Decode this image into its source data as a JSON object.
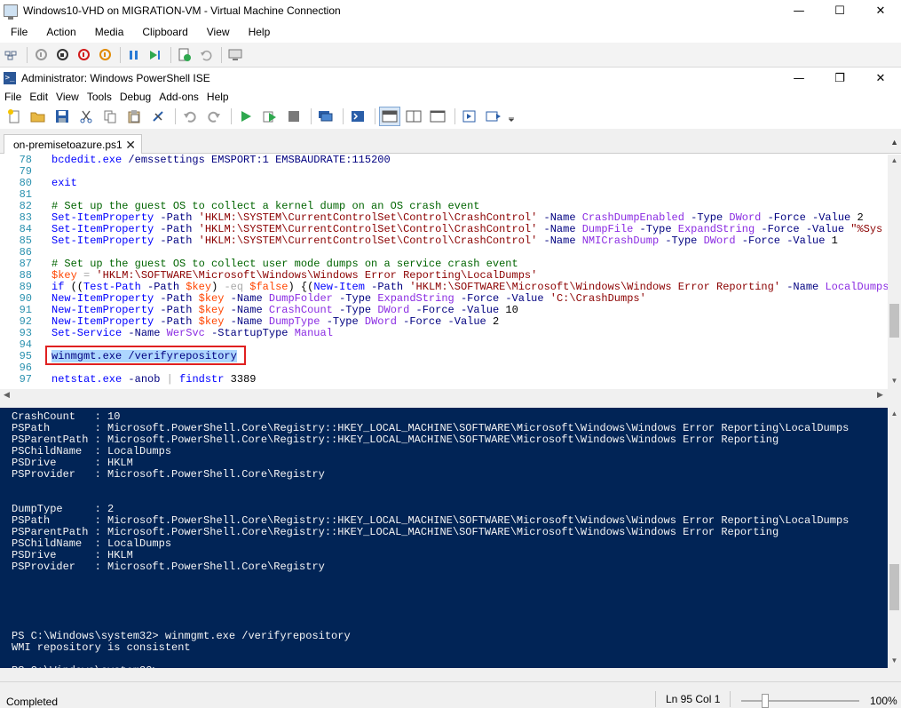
{
  "vm_window": {
    "title": "Windows10-VHD on MIGRATION-VM - Virtual Machine Connection",
    "menu": [
      "File",
      "Action",
      "Media",
      "Clipboard",
      "View",
      "Help"
    ]
  },
  "ise_window": {
    "title": "Administrator: Windows PowerShell ISE",
    "menu": [
      "File",
      "Edit",
      "View",
      "Tools",
      "Debug",
      "Add-ons",
      "Help"
    ]
  },
  "tab": {
    "label": "on-premisetoazure.ps1",
    "close": "✕"
  },
  "editor": {
    "lines": [
      {
        "num": "78",
        "parts": [
          [
            "cmd",
            "bcdedit.exe"
          ],
          [
            "plain",
            " "
          ],
          [
            "param",
            "/emssettings"
          ],
          [
            "plain",
            " "
          ],
          [
            "param",
            "EMSPORT:1"
          ],
          [
            "plain",
            " "
          ],
          [
            "param",
            "EMSBAUDRATE:115200"
          ]
        ]
      },
      {
        "num": "79",
        "parts": []
      },
      {
        "num": "80",
        "parts": [
          [
            "cmd",
            "exit"
          ]
        ]
      },
      {
        "num": "81",
        "parts": []
      },
      {
        "num": "82",
        "parts": [
          [
            "com",
            "# Set up the guest OS to collect a kernel dump on an OS crash event"
          ]
        ]
      },
      {
        "num": "83",
        "parts": [
          [
            "cmd",
            "Set-ItemProperty"
          ],
          [
            "plain",
            " "
          ],
          [
            "param",
            "-Path"
          ],
          [
            "plain",
            " "
          ],
          [
            "str",
            "'HKLM:\\SYSTEM\\CurrentControlSet\\Control\\CrashControl'"
          ],
          [
            "plain",
            " "
          ],
          [
            "param",
            "-Name"
          ],
          [
            "plain",
            " "
          ],
          [
            "type",
            "CrashDumpEnabled"
          ],
          [
            "plain",
            " "
          ],
          [
            "param",
            "-Type"
          ],
          [
            "plain",
            " "
          ],
          [
            "type",
            "DWord"
          ],
          [
            "plain",
            " "
          ],
          [
            "param",
            "-Force"
          ],
          [
            "plain",
            " "
          ],
          [
            "param",
            "-Value"
          ],
          [
            "plain",
            " "
          ],
          [
            "plain",
            "2"
          ]
        ]
      },
      {
        "num": "84",
        "parts": [
          [
            "cmd",
            "Set-ItemProperty"
          ],
          [
            "plain",
            " "
          ],
          [
            "param",
            "-Path"
          ],
          [
            "plain",
            " "
          ],
          [
            "str",
            "'HKLM:\\SYSTEM\\CurrentControlSet\\Control\\CrashControl'"
          ],
          [
            "plain",
            " "
          ],
          [
            "param",
            "-Name"
          ],
          [
            "plain",
            " "
          ],
          [
            "type",
            "DumpFile"
          ],
          [
            "plain",
            " "
          ],
          [
            "param",
            "-Type"
          ],
          [
            "plain",
            " "
          ],
          [
            "type",
            "ExpandString"
          ],
          [
            "plain",
            " "
          ],
          [
            "param",
            "-Force"
          ],
          [
            "plain",
            " "
          ],
          [
            "param",
            "-Value"
          ],
          [
            "plain",
            " "
          ],
          [
            "str",
            "\"%Sys"
          ]
        ]
      },
      {
        "num": "85",
        "parts": [
          [
            "cmd",
            "Set-ItemProperty"
          ],
          [
            "plain",
            " "
          ],
          [
            "param",
            "-Path"
          ],
          [
            "plain",
            " "
          ],
          [
            "str",
            "'HKLM:\\SYSTEM\\CurrentControlSet\\Control\\CrashControl'"
          ],
          [
            "plain",
            " "
          ],
          [
            "param",
            "-Name"
          ],
          [
            "plain",
            " "
          ],
          [
            "type",
            "NMICrashDump"
          ],
          [
            "plain",
            " "
          ],
          [
            "param",
            "-Type"
          ],
          [
            "plain",
            " "
          ],
          [
            "type",
            "DWord"
          ],
          [
            "plain",
            " "
          ],
          [
            "param",
            "-Force"
          ],
          [
            "plain",
            " "
          ],
          [
            "param",
            "-Value"
          ],
          [
            "plain",
            " "
          ],
          [
            "plain",
            "1"
          ]
        ]
      },
      {
        "num": "86",
        "parts": []
      },
      {
        "num": "87",
        "parts": [
          [
            "com",
            "# Set up the guest OS to collect user mode dumps on a service crash event"
          ]
        ]
      },
      {
        "num": "88",
        "parts": [
          [
            "var",
            "$key"
          ],
          [
            "plain",
            " "
          ],
          [
            "op",
            "="
          ],
          [
            "plain",
            " "
          ],
          [
            "str",
            "'HKLM:\\SOFTWARE\\Microsoft\\Windows\\Windows Error Reporting\\LocalDumps'"
          ]
        ]
      },
      {
        "num": "89",
        "parts": [
          [
            "cmd",
            "if"
          ],
          [
            "plain",
            " (("
          ],
          [
            "cmd",
            "Test-Path"
          ],
          [
            "plain",
            " "
          ],
          [
            "param",
            "-Path"
          ],
          [
            "plain",
            " "
          ],
          [
            "var",
            "$key"
          ],
          [
            "plain",
            ") "
          ],
          [
            "op",
            "-eq"
          ],
          [
            "plain",
            " "
          ],
          [
            "var",
            "$false"
          ],
          [
            "plain",
            ") {("
          ],
          [
            "cmd",
            "New-Item"
          ],
          [
            "plain",
            " "
          ],
          [
            "param",
            "-Path"
          ],
          [
            "plain",
            " "
          ],
          [
            "str",
            "'HKLM:\\SOFTWARE\\Microsoft\\Windows\\Windows Error Reporting'"
          ],
          [
            "plain",
            " "
          ],
          [
            "param",
            "-Name"
          ],
          [
            "plain",
            " "
          ],
          [
            "type",
            "LocalDumps"
          ]
        ]
      },
      {
        "num": "90",
        "parts": [
          [
            "cmd",
            "New-ItemProperty"
          ],
          [
            "plain",
            " "
          ],
          [
            "param",
            "-Path"
          ],
          [
            "plain",
            " "
          ],
          [
            "var",
            "$key"
          ],
          [
            "plain",
            " "
          ],
          [
            "param",
            "-Name"
          ],
          [
            "plain",
            " "
          ],
          [
            "type",
            "DumpFolder"
          ],
          [
            "plain",
            " "
          ],
          [
            "param",
            "-Type"
          ],
          [
            "plain",
            " "
          ],
          [
            "type",
            "ExpandString"
          ],
          [
            "plain",
            " "
          ],
          [
            "param",
            "-Force"
          ],
          [
            "plain",
            " "
          ],
          [
            "param",
            "-Value"
          ],
          [
            "plain",
            " "
          ],
          [
            "str",
            "'C:\\CrashDumps'"
          ]
        ]
      },
      {
        "num": "91",
        "parts": [
          [
            "cmd",
            "New-ItemProperty"
          ],
          [
            "plain",
            " "
          ],
          [
            "param",
            "-Path"
          ],
          [
            "plain",
            " "
          ],
          [
            "var",
            "$key"
          ],
          [
            "plain",
            " "
          ],
          [
            "param",
            "-Name"
          ],
          [
            "plain",
            " "
          ],
          [
            "type",
            "CrashCount"
          ],
          [
            "plain",
            " "
          ],
          [
            "param",
            "-Type"
          ],
          [
            "plain",
            " "
          ],
          [
            "type",
            "DWord"
          ],
          [
            "plain",
            " "
          ],
          [
            "param",
            "-Force"
          ],
          [
            "plain",
            " "
          ],
          [
            "param",
            "-Value"
          ],
          [
            "plain",
            " "
          ],
          [
            "plain",
            "10"
          ]
        ]
      },
      {
        "num": "92",
        "parts": [
          [
            "cmd",
            "New-ItemProperty"
          ],
          [
            "plain",
            " "
          ],
          [
            "param",
            "-Path"
          ],
          [
            "plain",
            " "
          ],
          [
            "var",
            "$key"
          ],
          [
            "plain",
            " "
          ],
          [
            "param",
            "-Name"
          ],
          [
            "plain",
            " "
          ],
          [
            "type",
            "DumpType"
          ],
          [
            "plain",
            " "
          ],
          [
            "param",
            "-Type"
          ],
          [
            "plain",
            " "
          ],
          [
            "type",
            "DWord"
          ],
          [
            "plain",
            " "
          ],
          [
            "param",
            "-Force"
          ],
          [
            "plain",
            " "
          ],
          [
            "param",
            "-Value"
          ],
          [
            "plain",
            " "
          ],
          [
            "plain",
            "2"
          ]
        ]
      },
      {
        "num": "93",
        "parts": [
          [
            "cmd",
            "Set-Service"
          ],
          [
            "plain",
            " "
          ],
          [
            "param",
            "-Name"
          ],
          [
            "plain",
            " "
          ],
          [
            "type",
            "WerSvc"
          ],
          [
            "plain",
            " "
          ],
          [
            "param",
            "-StartupType"
          ],
          [
            "plain",
            " "
          ],
          [
            "type",
            "Manual"
          ]
        ]
      },
      {
        "num": "94",
        "parts": []
      },
      {
        "num": "95",
        "parts": [
          [
            "sel",
            "winmgmt.exe /verifyrepository"
          ]
        ]
      },
      {
        "num": "96",
        "parts": []
      },
      {
        "num": "97",
        "parts": [
          [
            "cmd",
            "netstat.exe"
          ],
          [
            "plain",
            " "
          ],
          [
            "param",
            "-anob"
          ],
          [
            "plain",
            " "
          ],
          [
            "op",
            "|"
          ],
          [
            "plain",
            " "
          ],
          [
            "cmd",
            "findstr"
          ],
          [
            "plain",
            " "
          ],
          [
            "plain",
            "3389"
          ]
        ]
      }
    ]
  },
  "console": {
    "lines": [
      "CrashCount   : 10",
      "PSPath       : Microsoft.PowerShell.Core\\Registry::HKEY_LOCAL_MACHINE\\SOFTWARE\\Microsoft\\Windows\\Windows Error Reporting\\LocalDumps",
      "PSParentPath : Microsoft.PowerShell.Core\\Registry::HKEY_LOCAL_MACHINE\\SOFTWARE\\Microsoft\\Windows\\Windows Error Reporting",
      "PSChildName  : LocalDumps",
      "PSDrive      : HKLM",
      "PSProvider   : Microsoft.PowerShell.Core\\Registry",
      "",
      "",
      "DumpType     : 2",
      "PSPath       : Microsoft.PowerShell.Core\\Registry::HKEY_LOCAL_MACHINE\\SOFTWARE\\Microsoft\\Windows\\Windows Error Reporting\\LocalDumps",
      "PSParentPath : Microsoft.PowerShell.Core\\Registry::HKEY_LOCAL_MACHINE\\SOFTWARE\\Microsoft\\Windows\\Windows Error Reporting",
      "PSChildName  : LocalDumps",
      "PSDrive      : HKLM",
      "PSProvider   : Microsoft.PowerShell.Core\\Registry",
      "",
      "",
      "",
      "",
      "",
      "PS C:\\Windows\\system32> winmgmt.exe /verifyrepository",
      "WMI repository is consistent",
      "",
      "PS C:\\Windows\\system32>"
    ]
  },
  "statusbar": {
    "text": "Completed",
    "position": "Ln 95  Col 1",
    "zoom": "100%"
  },
  "colors": {
    "console_bg": "#012456",
    "highlight_box": "#e02020",
    "selection": "#add6ff"
  }
}
